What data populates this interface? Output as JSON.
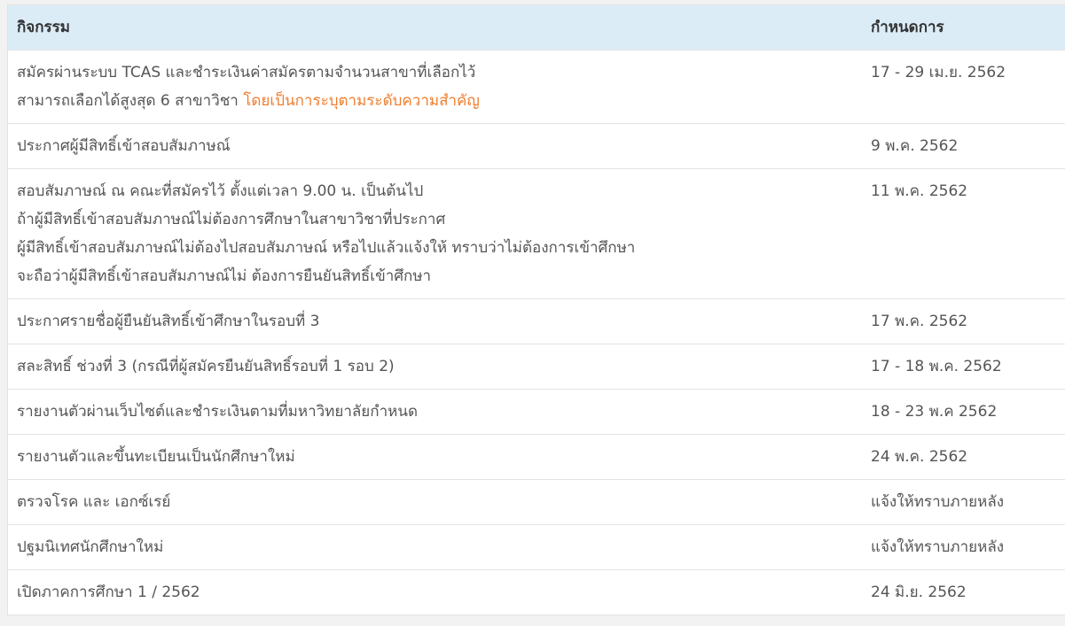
{
  "table": {
    "headers": {
      "activity": "กิจกรรม",
      "date": "กำหนดการ"
    },
    "rows": [
      {
        "activity_lines": [
          "สมัครผ่านระบบ TCAS และชำระเงินค่าสมัครตามจำนวนสาขาที่เลือกไว้",
          "สามารถเลือกได้สูงสุด 6 สาขาวิชา "
        ],
        "activity_highlight": "โดยเป็นการะบุตามระดับความสำคัญ",
        "date": "17 - 29 เม.ย. 2562"
      },
      {
        "activity_lines": [
          "ประกาศผู้มีสิทธิ์เข้าสอบสัมภาษณ์"
        ],
        "date": "9 พ.ค. 2562"
      },
      {
        "activity_lines": [
          "สอบสัมภาษณ์ ณ คณะที่สมัครไว้ ตั้งแต่เวลา 9.00 น. เป็นต้นไป",
          "ถ้าผู้มีสิทธิ์เข้าสอบสัมภาษณ์ไม่ต้องการศึกษาในสาขาวิชาที่ประกาศ",
          "ผู้มีสิทธิ์เข้าสอบสัมภาษณ์ไม่ต้องไปสอบสัมภาษณ์ หรือไปแล้วแจ้งให้ ทราบว่าไม่ต้องการเข้าศึกษา",
          "จะถือว่าผู้มีสิทธิ์เข้าสอบสัมภาษณ์ไม่ ต้องการยืนยันสิทธิ์เข้าศึกษา"
        ],
        "date": "11 พ.ค. 2562"
      },
      {
        "activity_lines": [
          "ประกาศรายชื่อผู้ยืนยันสิทธิ์เข้าศึกษาในรอบที่ 3"
        ],
        "date": "17 พ.ค. 2562"
      },
      {
        "activity_lines": [
          "สละสิทธิ์ ช่วงที่ 3 (กรณีที่ผู้สมัครยืนยันสิทธิ์รอบที่ 1 รอบ 2)"
        ],
        "date": "17 - 18 พ.ค. 2562"
      },
      {
        "activity_lines": [
          "รายงานตัวผ่านเว็บไซต์และชำระเงินตามที่มหาวิทยาลัยกำหนด"
        ],
        "date": "18 - 23 พ.ค 2562"
      },
      {
        "activity_lines": [
          "รายงานตัวและขึ้นทะเบียนเป็นนักศึกษาใหม่"
        ],
        "date": "24 พ.ค. 2562"
      },
      {
        "activity_lines": [
          "ตรวจโรค และ เอกซ์เรย์"
        ],
        "date": "แจ้งให้ทราบภายหลัง"
      },
      {
        "activity_lines": [
          "ปฐมนิเทศนักศึกษาใหม่"
        ],
        "date": "แจ้งให้ทราบภายหลัง"
      },
      {
        "activity_lines": [
          "เปิดภาคการศึกษา 1 / 2562"
        ],
        "date": "24 มิ.ย. 2562"
      }
    ]
  }
}
